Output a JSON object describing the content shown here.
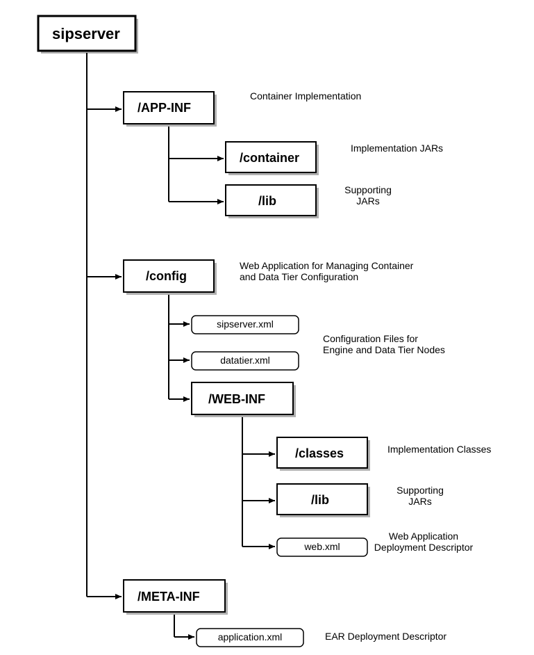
{
  "root": {
    "label": "sipserver"
  },
  "nodes": {
    "appinf": {
      "label": "/APP-INF",
      "desc": "Container Implementation"
    },
    "container": {
      "label": "/container",
      "desc": "Implementation JARs"
    },
    "appinf_lib": {
      "label": "/lib",
      "desc1": "Supporting",
      "desc2": "JARs"
    },
    "config": {
      "label": "/config",
      "desc1": "Web Application for Managing Container",
      "desc2": "and Data Tier Configuration"
    },
    "sipserver_xml": {
      "label": "sipserver.xml"
    },
    "datatier_xml": {
      "label": "datatier.xml"
    },
    "config_files_desc1": "Configuration Files for",
    "config_files_desc2": "Engine and Data Tier Nodes",
    "webinf": {
      "label": "/WEB-INF"
    },
    "classes": {
      "label": "/classes",
      "desc": "Implementation Classes"
    },
    "webinf_lib": {
      "label": "/lib",
      "desc1": "Supporting",
      "desc2": "JARs"
    },
    "web_xml": {
      "label": "web.xml",
      "desc1": "Web Application",
      "desc2": "Deployment Descriptor"
    },
    "metainf": {
      "label": "/META-INF"
    },
    "application_xml": {
      "label": "application.xml",
      "desc": "EAR Deployment Descriptor"
    }
  }
}
